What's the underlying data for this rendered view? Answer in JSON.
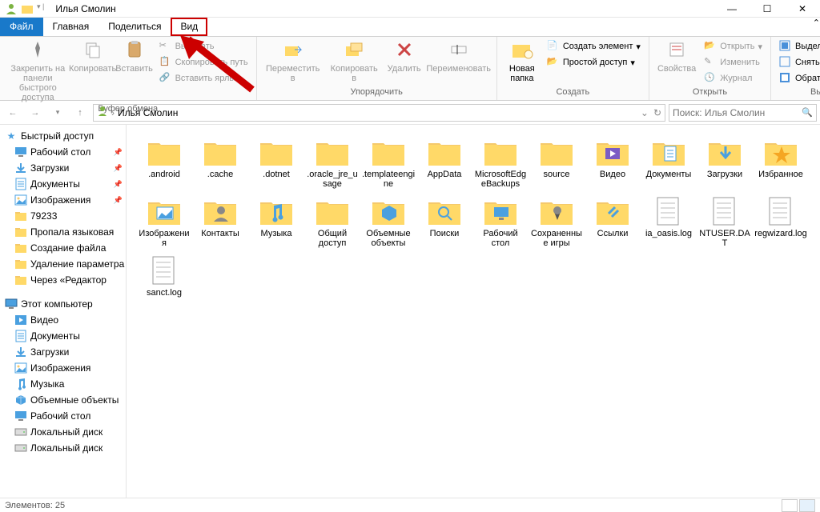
{
  "window_title": "Илья Смолин",
  "tabs": {
    "file": "Файл",
    "home": "Главная",
    "share": "Поделиться",
    "view": "Вид"
  },
  "ribbon": {
    "clipboard": {
      "label": "Буфер обмена",
      "pin": "Закрепить на панели быстрого доступа",
      "copy": "Копировать",
      "paste": "Вставить",
      "cut": "Вырезать",
      "copy_path": "Скопировать путь",
      "paste_link": "Вставить ярлык"
    },
    "organize": {
      "label": "Упорядочить",
      "move_to": "Переместить в",
      "copy_to": "Копировать в",
      "delete": "Удалить",
      "rename": "Переименовать"
    },
    "new": {
      "label": "Создать",
      "new_folder": "Новая папка",
      "create_item": "Создать элемент",
      "easy_access": "Простой доступ"
    },
    "open_g": {
      "label": "Открыть",
      "properties": "Свойства",
      "open": "Открыть",
      "edit": "Изменить",
      "history": "Журнал"
    },
    "select": {
      "label": "Выделить",
      "select_all": "Выделить все",
      "select_none": "Снять выделение",
      "invert": "Обратить выделение"
    }
  },
  "breadcrumb": "Илья Смолин",
  "search_placeholder": "Поиск: Илья Смолин",
  "sidebar": {
    "quick": "Быстрый доступ",
    "quick_items": [
      {
        "label": "Рабочий стол",
        "pinned": true,
        "ico": "desktop"
      },
      {
        "label": "Загрузки",
        "pinned": true,
        "ico": "downloads"
      },
      {
        "label": "Документы",
        "pinned": true,
        "ico": "docs"
      },
      {
        "label": "Изображения",
        "pinned": true,
        "ico": "pics"
      },
      {
        "label": "79233",
        "pinned": false,
        "ico": "folder"
      },
      {
        "label": "Пропала языковая",
        "pinned": false,
        "ico": "folder"
      },
      {
        "label": "Создание файла",
        "pinned": false,
        "ico": "folder"
      },
      {
        "label": "Удаление параметра",
        "pinned": false,
        "ico": "folder"
      },
      {
        "label": "Через «Редактор",
        "pinned": false,
        "ico": "folder"
      }
    ],
    "this_pc": "Этот компьютер",
    "pc_items": [
      {
        "label": "Видео",
        "ico": "video"
      },
      {
        "label": "Документы",
        "ico": "docs"
      },
      {
        "label": "Загрузки",
        "ico": "downloads"
      },
      {
        "label": "Изображения",
        "ico": "pics"
      },
      {
        "label": "Музыка",
        "ico": "music"
      },
      {
        "label": "Объемные объекты",
        "ico": "3d"
      },
      {
        "label": "Рабочий стол",
        "ico": "desktop"
      },
      {
        "label": "Локальный диск",
        "ico": "disk"
      },
      {
        "label": "Локальный диск",
        "ico": "disk"
      }
    ]
  },
  "items": [
    {
      "name": ".android",
      "type": "folder"
    },
    {
      "name": ".cache",
      "type": "folder"
    },
    {
      "name": ".dotnet",
      "type": "folder"
    },
    {
      "name": ".oracle_jre_usage",
      "type": "folder"
    },
    {
      "name": ".templateengine",
      "type": "folder"
    },
    {
      "name": "AppData",
      "type": "folder"
    },
    {
      "name": "MicrosoftEdgeBackups",
      "type": "folder"
    },
    {
      "name": "source",
      "type": "folder"
    },
    {
      "name": "Видео",
      "type": "video"
    },
    {
      "name": "Документы",
      "type": "docs"
    },
    {
      "name": "Загрузки",
      "type": "downloads"
    },
    {
      "name": "Избранное",
      "type": "favorites"
    },
    {
      "name": "Изображения",
      "type": "pictures"
    },
    {
      "name": "Контакты",
      "type": "contacts"
    },
    {
      "name": "Музыка",
      "type": "music"
    },
    {
      "name": "Общий доступ",
      "type": "folder"
    },
    {
      "name": "Объемные объекты",
      "type": "3d"
    },
    {
      "name": "Поиски",
      "type": "search"
    },
    {
      "name": "Рабочий стол",
      "type": "desktop"
    },
    {
      "name": "Сохраненные игры",
      "type": "games"
    },
    {
      "name": "Ссылки",
      "type": "links"
    },
    {
      "name": "ia_oasis.log",
      "type": "file"
    },
    {
      "name": "NTUSER.DAT",
      "type": "file"
    },
    {
      "name": "regwizard.log",
      "type": "file"
    },
    {
      "name": "sanct.log",
      "type": "file"
    }
  ],
  "status": "Элементов: 25"
}
